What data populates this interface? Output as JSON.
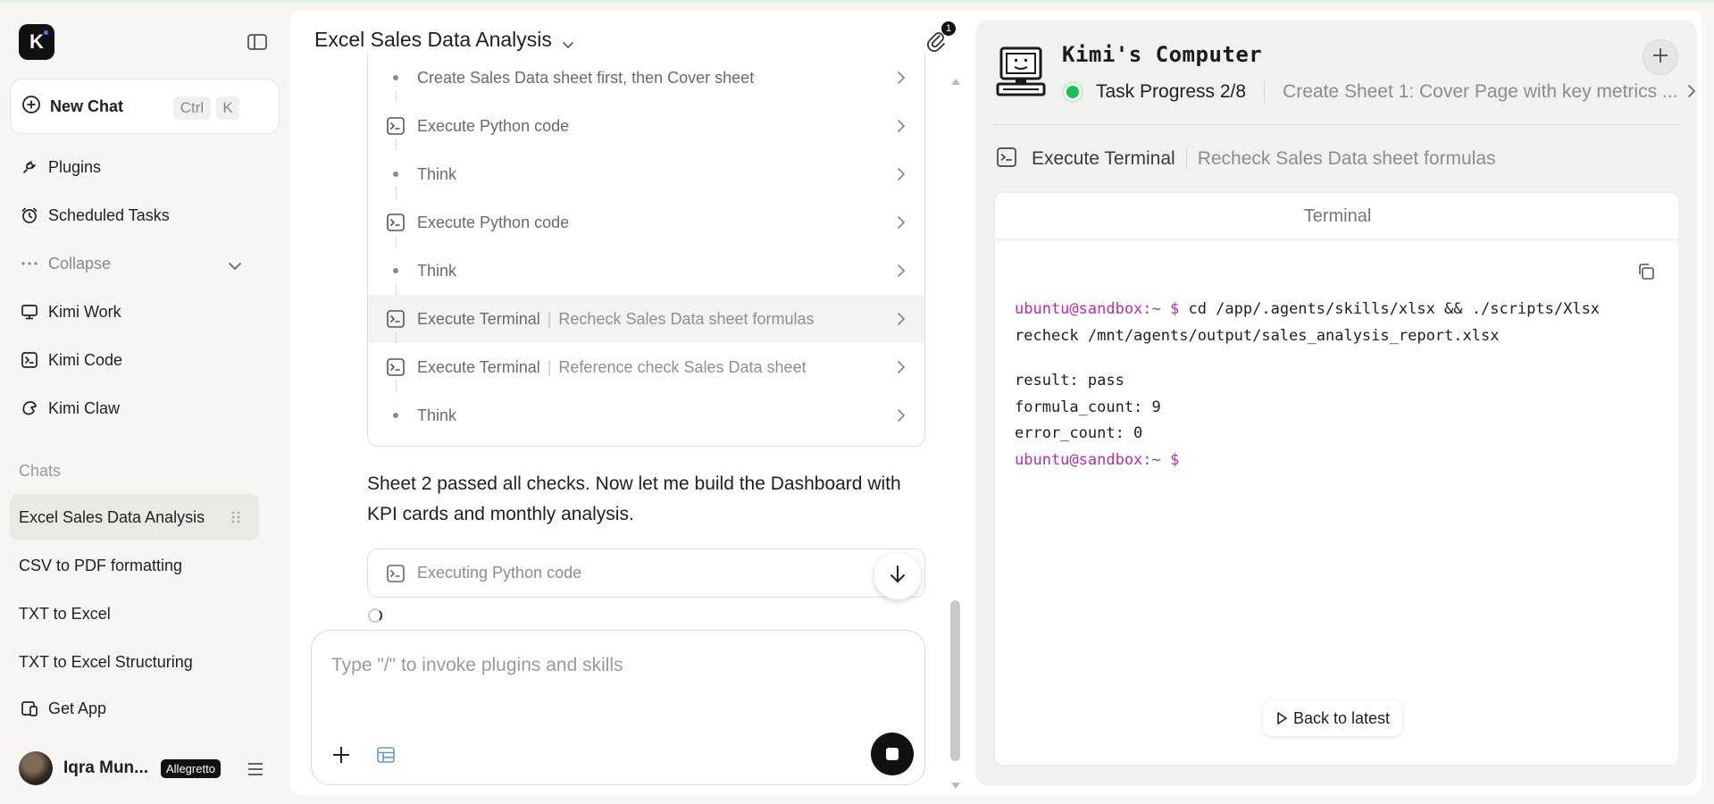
{
  "sidebar": {
    "logo_letter": "K",
    "new_chat": {
      "label": "New Chat",
      "shortcut_mod": "Ctrl",
      "shortcut_key": "K"
    },
    "nav": [
      {
        "label": "Plugins",
        "icon": "plug-icon"
      },
      {
        "label": "Scheduled Tasks",
        "icon": "alarm-clock-icon"
      },
      {
        "label": "Collapse",
        "icon": "more-dots-icon"
      },
      {
        "label": "Kimi Work",
        "icon": "monitor-icon"
      },
      {
        "label": "Kimi Code",
        "icon": "terminal-icon"
      },
      {
        "label": "Kimi Claw",
        "icon": "claw-icon"
      }
    ],
    "chats_title": "Chats",
    "chats": [
      {
        "label": "Excel Sales Data Analysis"
      },
      {
        "label": "CSV to PDF formatting"
      },
      {
        "label": "TXT to Excel"
      },
      {
        "label": "TXT to Excel Structuring"
      }
    ],
    "get_app": "Get App",
    "user": {
      "name": "Iqra Mun...",
      "plan": "Allegretto"
    }
  },
  "conversation": {
    "title": "Excel Sales Data Analysis",
    "attachments_count": "1",
    "steps": [
      {
        "type": "think",
        "title": "Create Sales Data sheet first, then Cover sheet",
        "detail": ""
      },
      {
        "type": "tool",
        "title": "Execute Python code",
        "detail": ""
      },
      {
        "type": "think",
        "title": "Think",
        "detail": ""
      },
      {
        "type": "tool",
        "title": "Execute Python code",
        "detail": ""
      },
      {
        "type": "think",
        "title": "Think",
        "detail": ""
      },
      {
        "type": "tool",
        "title": "Execute Terminal",
        "detail": "Recheck Sales Data sheet formulas",
        "active": true
      },
      {
        "type": "tool",
        "title": "Execute Terminal",
        "detail": "Reference check Sales Data sheet"
      },
      {
        "type": "think",
        "title": "Think",
        "detail": ""
      }
    ],
    "message": "Sheet 2 passed all checks. Now let me build the Dashboard with KPI cards and monthly analysis.",
    "executing_label": "Executing Python code",
    "composer_placeholder": "Type \"/\" to invoke plugins and skills"
  },
  "computer": {
    "title": "Kimi's Computer",
    "progress_label": "Task Progress 2/8",
    "current_task": "Create Sheet 1: Cover Page with key metrics ...",
    "tool_name": "Execute Terminal",
    "tool_detail": "Recheck Sales Data sheet formulas",
    "terminal": {
      "title": "Terminal",
      "prompt": "ubuntu@sandbox:~ $",
      "command_line1": " cd /app/.agents/skills/xlsx && ./scripts/Xlsx",
      "command_line2": "recheck /mnt/agents/output/sales_analysis_report.xlsx",
      "output": [
        "result: pass",
        "formula_count: 9",
        "error_count: 0"
      ],
      "final_prompt": "ubuntu@sandbox:~ $"
    },
    "back_to_latest": "Back to latest"
  },
  "colors": {
    "accent_green": "#18c05a",
    "prompt_magenta": "#b52bb5",
    "brand_dark": "#111111"
  }
}
